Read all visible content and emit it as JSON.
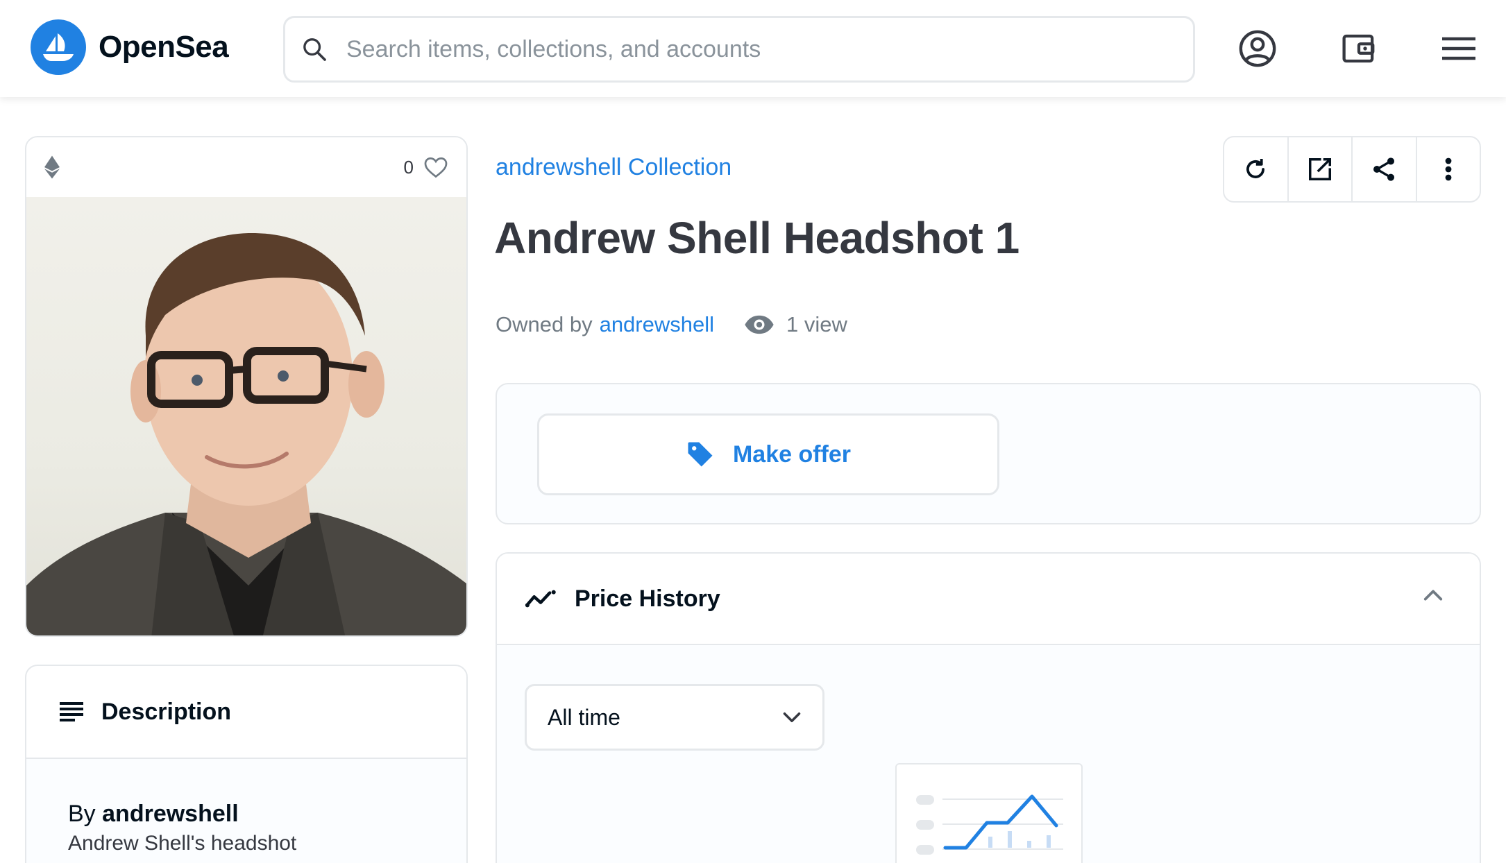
{
  "header": {
    "brand": "OpenSea",
    "search_placeholder": "Search items, collections, and accounts",
    "icons": [
      "profile-icon",
      "wallet-icon",
      "menu-icon"
    ]
  },
  "media": {
    "favorites_count": "0",
    "chain_icon": "ethereum-icon"
  },
  "description": {
    "title": "Description",
    "by_prefix": "By",
    "creator": "andrewshell",
    "text": "Andrew Shell's headshot"
  },
  "item": {
    "collection": "andrewshell Collection",
    "title": "Andrew Shell Headshot 1",
    "owned_by_label": "Owned by",
    "owner": "andrewshell",
    "views": "1 view"
  },
  "actions": [
    "refresh-icon",
    "external-link-icon",
    "share-icon",
    "more-icon"
  ],
  "offer": {
    "label": "Make offer"
  },
  "price_history": {
    "title": "Price History",
    "range_selected": "All time"
  },
  "colors": {
    "accent": "#2081e2",
    "border": "#e5e8eb",
    "text": "#04111d",
    "muted": "#707a83"
  }
}
